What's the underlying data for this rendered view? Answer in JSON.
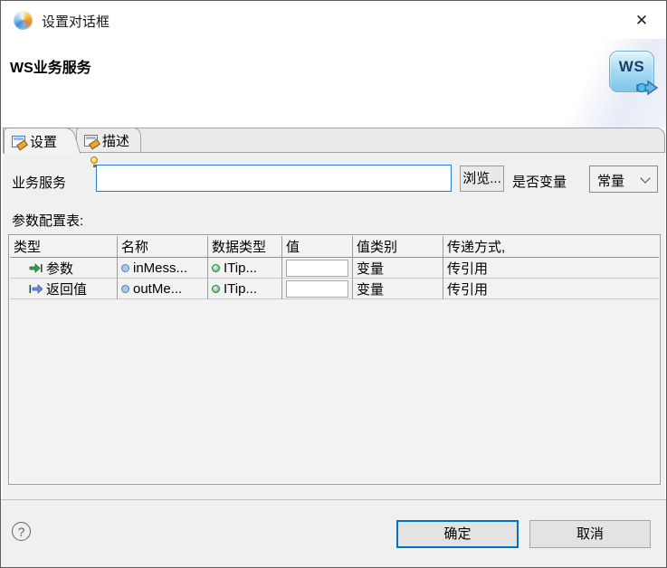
{
  "window": {
    "title": "设置对话框",
    "close_glyph": "✕"
  },
  "header": {
    "title": "WS业务服务",
    "ws_badge": "WS"
  },
  "tabs": {
    "settings": "设置",
    "description": "描述"
  },
  "form": {
    "service_label": "业务服务",
    "service_value": "",
    "browse_label": "浏览...",
    "is_variable_label": "是否变量",
    "variable_mode_value": "常量"
  },
  "table": {
    "caption": "参数配置表:",
    "columns": [
      "类型",
      "名称",
      "数据类型",
      "值",
      "值类别",
      "传递方式,"
    ],
    "rows": [
      {
        "type": "参数",
        "name": "inMess...",
        "data_type": "ITip...",
        "value": "",
        "value_category": "变量",
        "pass_mode": "传引用"
      },
      {
        "type": "返回值",
        "name": "outMe...",
        "data_type": "ITip...",
        "value": "",
        "value_category": "变量",
        "pass_mode": "传引用"
      }
    ]
  },
  "footer": {
    "help_glyph": "?",
    "ok_label": "确定",
    "cancel_label": "取消"
  },
  "colors": {
    "accent": "#0072c6",
    "focus_border": "#2b7cd3",
    "param_green": "#2e9e4f",
    "return_blue": "#6b8fd8"
  }
}
